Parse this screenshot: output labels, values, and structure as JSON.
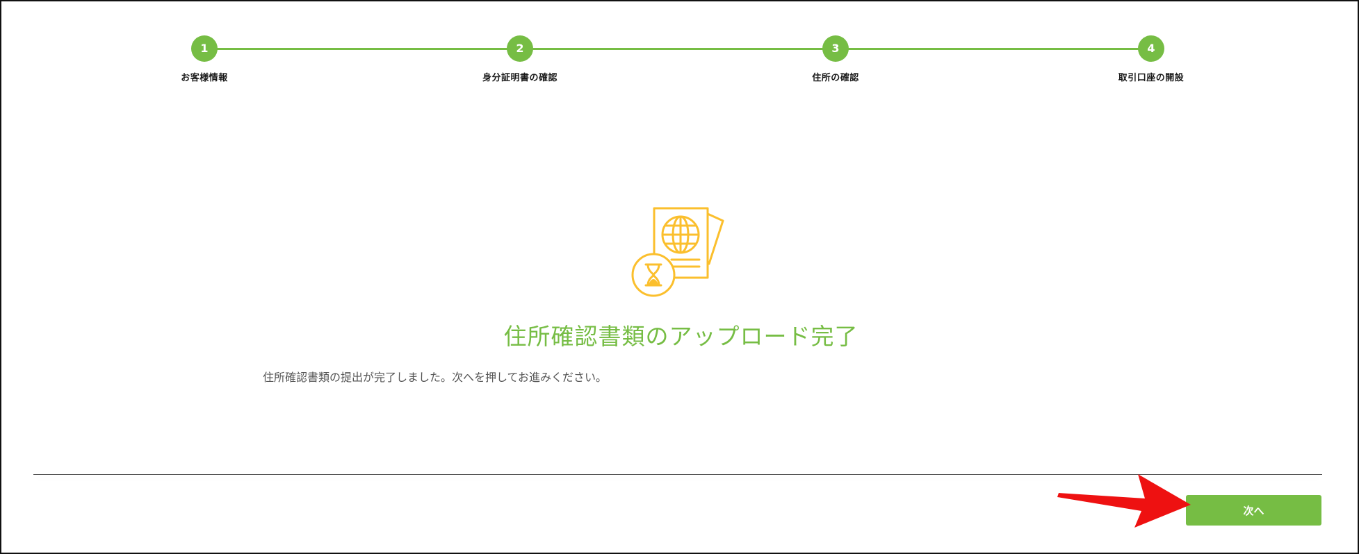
{
  "stepper": {
    "accent_color": "#76bd44",
    "steps": [
      {
        "number": "1",
        "label": "お客様情報"
      },
      {
        "number": "2",
        "label": "身分証明書の確認"
      },
      {
        "number": "3",
        "label": "住所の確認"
      },
      {
        "number": "4",
        "label": "取引口座の開設"
      }
    ]
  },
  "main": {
    "illustration_icon": "passport-hourglass-icon",
    "illustration_color": "#fbbf2d",
    "title": "住所確認書類のアップロード完了",
    "message": "住所確認書類の提出が完了しました。次へを押してお進みください。"
  },
  "footer": {
    "next_label": "次へ",
    "annotation_icon": "red-arrow-icon",
    "annotation_color": "#ee1111"
  }
}
